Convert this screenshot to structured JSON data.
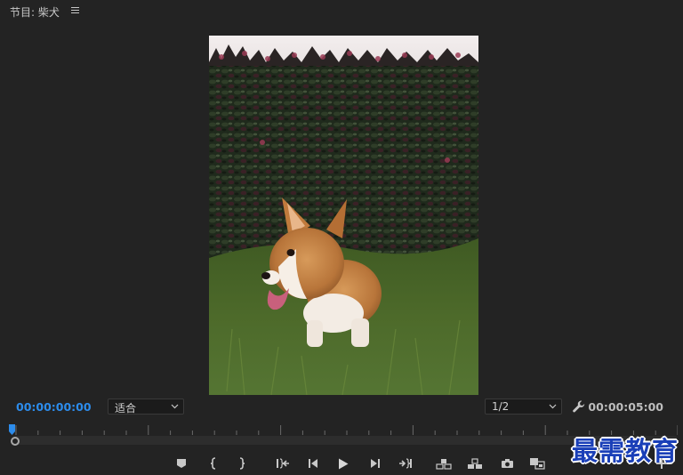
{
  "panel": {
    "title": "节目: 柴犬",
    "menu_icon": "hamburger-icon"
  },
  "monitor": {
    "subject": "corgi-dog-photo"
  },
  "timecode": {
    "current": "00:00:00:00",
    "duration": "00:00:05:00"
  },
  "zoom_select": {
    "value": "适合"
  },
  "resolution_select": {
    "value": "1/2"
  },
  "settings_icon": "wrench-icon",
  "playback_position": 0,
  "controls": [
    {
      "name": "add-marker-button",
      "icon": "marker-icon"
    },
    {
      "name": "mark-in-button",
      "icon": "mark-in-icon"
    },
    {
      "name": "mark-out-button",
      "icon": "mark-out-icon"
    },
    {
      "name": "go-to-in-button",
      "icon": "go-to-in-icon"
    },
    {
      "name": "step-back-button",
      "icon": "step-back-icon"
    },
    {
      "name": "play-button",
      "icon": "play-icon"
    },
    {
      "name": "step-forward-button",
      "icon": "step-forward-icon"
    },
    {
      "name": "go-to-out-button",
      "icon": "go-to-out-icon"
    },
    {
      "name": "lift-button",
      "icon": "lift-icon"
    },
    {
      "name": "extract-button",
      "icon": "extract-icon"
    },
    {
      "name": "export-frame-button",
      "icon": "camera-icon"
    },
    {
      "name": "compare-view-button",
      "icon": "compare-icon"
    }
  ],
  "add_button_icon": "plus-icon",
  "watermark": "最需教育",
  "colors": {
    "background": "#232323",
    "timecode_active": "#2d8ceb",
    "watermark": "#1a3fb8"
  }
}
